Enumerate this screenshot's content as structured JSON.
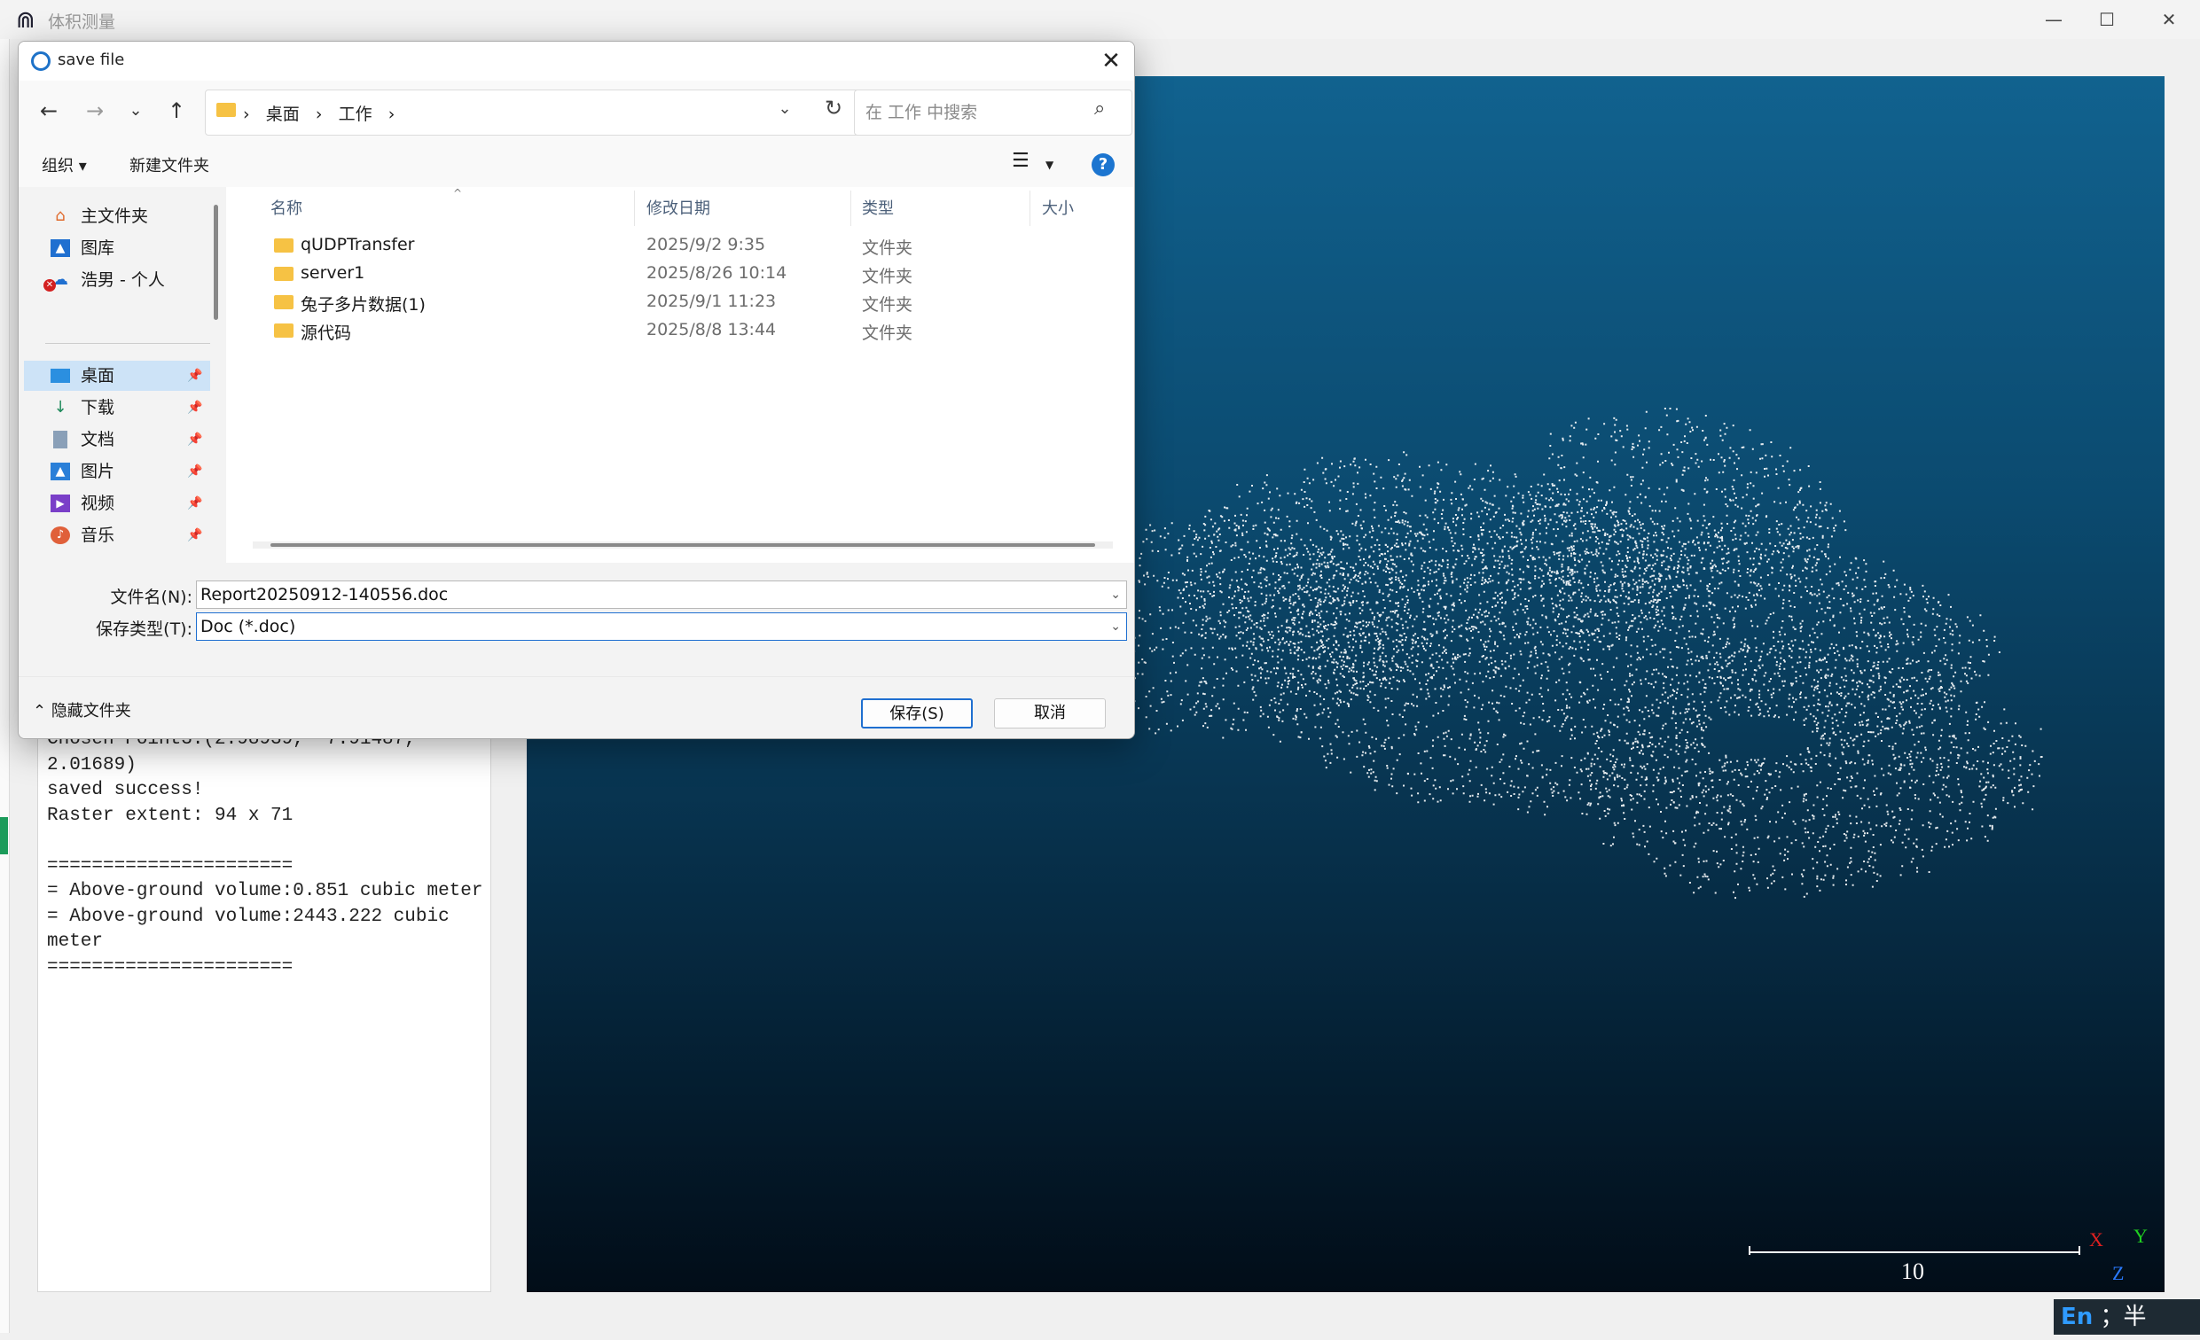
{
  "app": {
    "title": "体积测量",
    "minimize_icon": "minimize-icon",
    "maximize_icon": "maximize-icon",
    "close_icon": "close-icon"
  },
  "log": {
    "text": "Chosen Point3:(2.98939, -7.91487,\n2.01689)\nsaved success!\nRaster extent: 94 x 71\n\n======================\n= Above-ground volume:0.851 cubic meter\n= Above-ground volume:2443.222 cubic\nmeter\n======================"
  },
  "viewer": {
    "scale_label": "10",
    "axis_x": "X",
    "axis_y": "Y",
    "axis_z": "Z",
    "background_top": "#11628f",
    "background_bottom": "#020d18"
  },
  "ime": {
    "lang": "En",
    "mode": "；半"
  },
  "dialog": {
    "title": "save file",
    "address": {
      "crumbs": [
        "桌面",
        "工作"
      ]
    },
    "search": {
      "placeholder": "在 工作 中搜索"
    },
    "toolbar": {
      "organize": "组织 ▾",
      "new_folder": "新建文件夹",
      "help": "?"
    },
    "nav": {
      "items": [
        {
          "label": "主文件夹",
          "icon": "home-icon"
        },
        {
          "label": "图库",
          "icon": "gallery-icon"
        },
        {
          "label": "浩男 - 个人",
          "icon": "onedrive-icon"
        },
        {
          "label": "桌面",
          "icon": "desktop-icon"
        },
        {
          "label": "下载",
          "icon": "download-icon"
        },
        {
          "label": "文档",
          "icon": "documents-icon"
        },
        {
          "label": "图片",
          "icon": "pictures-icon"
        },
        {
          "label": "视频",
          "icon": "videos-icon"
        },
        {
          "label": "音乐",
          "icon": "music-icon"
        }
      ]
    },
    "columns": {
      "name": "名称",
      "date": "修改日期",
      "type": "类型",
      "size": "大小"
    },
    "files": [
      {
        "name": "qUDPTransfer",
        "date": "2025/9/2 9:35",
        "type": "文件夹"
      },
      {
        "name": "server1",
        "date": "2025/8/26 10:14",
        "type": "文件夹"
      },
      {
        "name": "兔子多片数据(1)",
        "date": "2025/9/1 11:23",
        "type": "文件夹"
      },
      {
        "name": "源代码",
        "date": "2025/8/8 13:44",
        "type": "文件夹"
      }
    ],
    "form": {
      "filename_label": "文件名(N):",
      "filename_value": "Report20250912-140556.doc",
      "filetype_label": "保存类型(T):",
      "filetype_value": "Doc (*.doc)"
    },
    "footer": {
      "hide_folders": "隐藏文件夹",
      "save": "保存(S)",
      "cancel": "取消"
    }
  }
}
